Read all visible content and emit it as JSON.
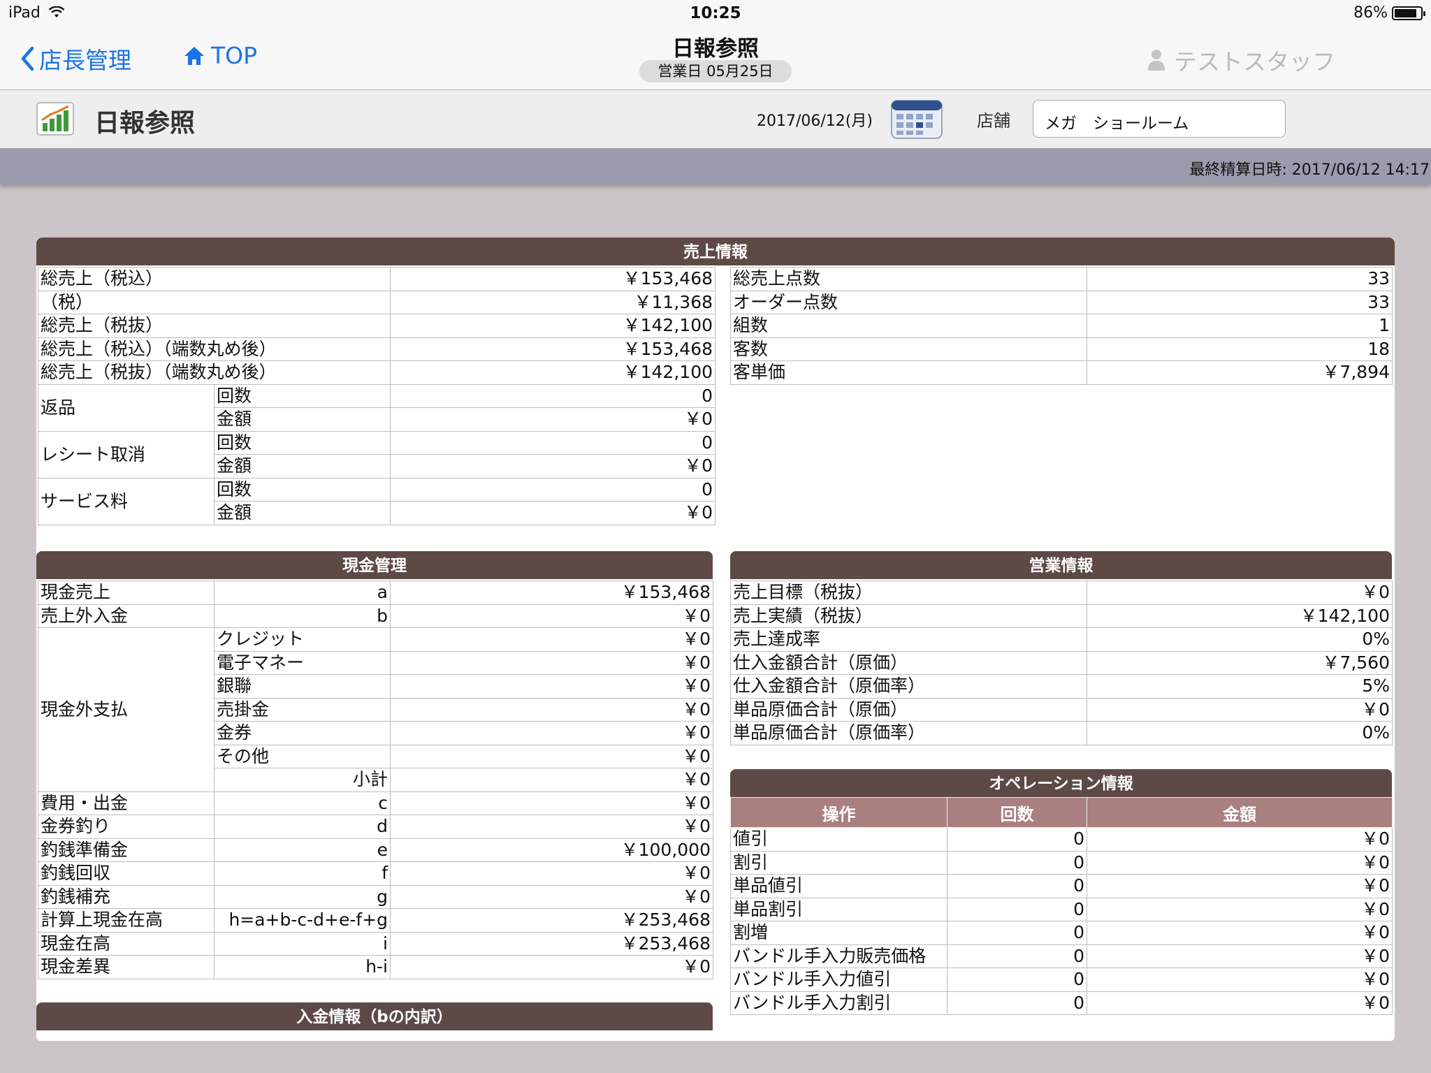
{
  "status_bar": {
    "device": "iPad",
    "time": "10:25",
    "battery": "86%",
    "battery_level": 0.86
  },
  "nav": {
    "back_label": "店長管理",
    "top_label": "TOP",
    "title": "日報参照",
    "subtitle": "営業日 05月25日",
    "user": "テストスタッフ"
  },
  "header": {
    "title": "日報参照",
    "date": "2017/06/12(月)",
    "store_label": "店舗",
    "store_value": "メガ　ショールーム",
    "last_settled": "最終精算日時: 2017/06/12 14:17"
  },
  "sales": {
    "title": "売上情報",
    "left_simple": [
      {
        "label": "総売上（税込）",
        "value": "￥153,468"
      },
      {
        "label": "（税）",
        "value": "￥11,368"
      },
      {
        "label": "総売上（税抜）",
        "value": "￥142,100"
      },
      {
        "label": "総売上（税込）（端数丸め後）",
        "value": "￥153,468"
      },
      {
        "label": "総売上（税抜）（端数丸め後）",
        "value": "￥142,100"
      }
    ],
    "left_groups": [
      {
        "label": "返品",
        "rows": [
          {
            "label": "回数",
            "value": "0"
          },
          {
            "label": "金額",
            "value": "￥0"
          }
        ]
      },
      {
        "label": "レシート取消",
        "rows": [
          {
            "label": "回数",
            "value": "0"
          },
          {
            "label": "金額",
            "value": "￥0"
          }
        ]
      },
      {
        "label": "サービス料",
        "rows": [
          {
            "label": "回数",
            "value": "0"
          },
          {
            "label": "金額",
            "value": "￥0"
          }
        ]
      }
    ],
    "right": [
      {
        "label": "総売上点数",
        "value": "33"
      },
      {
        "label": "オーダー点数",
        "value": "33"
      },
      {
        "label": "組数",
        "value": "1"
      },
      {
        "label": "客数",
        "value": "18"
      },
      {
        "label": "客単価",
        "value": "￥7,894"
      }
    ]
  },
  "cash": {
    "title": "現金管理",
    "top_rows": [
      {
        "label": "現金売上",
        "code": "a",
        "value": "￥153,468"
      },
      {
        "label": "売上外入金",
        "code": "b",
        "value": "￥0"
      }
    ],
    "noncash_label": "現金外支払",
    "noncash_rows": [
      {
        "label": "クレジット",
        "value": "￥0"
      },
      {
        "label": "電子マネー",
        "value": "￥0"
      },
      {
        "label": "銀聯",
        "value": "￥0"
      },
      {
        "label": "売掛金",
        "value": "￥0"
      },
      {
        "label": "金券",
        "value": "￥0"
      },
      {
        "label": "その他",
        "value": "￥0"
      }
    ],
    "subtotal_label": "小計",
    "subtotal_value": "￥0",
    "bottom_rows": [
      {
        "label": "費用・出金",
        "code": "c",
        "value": "￥0"
      },
      {
        "label": "金券釣り",
        "code": "d",
        "value": "￥0"
      },
      {
        "label": "釣銭準備金",
        "code": "e",
        "value": "￥100,000"
      },
      {
        "label": "釣銭回収",
        "code": "f",
        "value": "￥0"
      },
      {
        "label": "釣銭補充",
        "code": "g",
        "value": "￥0"
      },
      {
        "label": "計算上現金在高",
        "code": "h=a+b-c-d+e-f+g",
        "value": "￥253,468"
      },
      {
        "label": "現金在高",
        "code": "i",
        "value": "￥253,468"
      },
      {
        "label": "現金差異",
        "code": "h-i",
        "value": "￥0"
      }
    ]
  },
  "deposit": {
    "title": "入金情報（bの内訳）"
  },
  "business": {
    "title": "営業情報",
    "rows": [
      {
        "label": "売上目標（税抜）",
        "value": "￥0"
      },
      {
        "label": "売上実績（税抜）",
        "value": "￥142,100"
      },
      {
        "label": "売上達成率",
        "value": "0%"
      },
      {
        "label": "仕入金額合計（原価）",
        "value": "￥7,560"
      },
      {
        "label": "仕入金額合計（原価率）",
        "value": "5%"
      },
      {
        "label": "単品原価合計（原価）",
        "value": "￥0"
      },
      {
        "label": "単品原価合計（原価率）",
        "value": "0%"
      }
    ]
  },
  "operation": {
    "title": "オペレーション情報",
    "columns": [
      "操作",
      "回数",
      "金額"
    ],
    "rows": [
      {
        "label": "値引",
        "count": "0",
        "amount": "￥0"
      },
      {
        "label": "割引",
        "count": "0",
        "amount": "￥0"
      },
      {
        "label": "単品値引",
        "count": "0",
        "amount": "￥0"
      },
      {
        "label": "単品割引",
        "count": "0",
        "amount": "￥0"
      },
      {
        "label": "割増",
        "count": "0",
        "amount": "￥0"
      },
      {
        "label": "バンドル手入力販売価格",
        "count": "0",
        "amount": "￥0"
      },
      {
        "label": "バンドル手入力値引",
        "count": "0",
        "amount": "￥0"
      },
      {
        "label": "バンドル手入力割引",
        "count": "0",
        "amount": "￥0"
      }
    ]
  }
}
